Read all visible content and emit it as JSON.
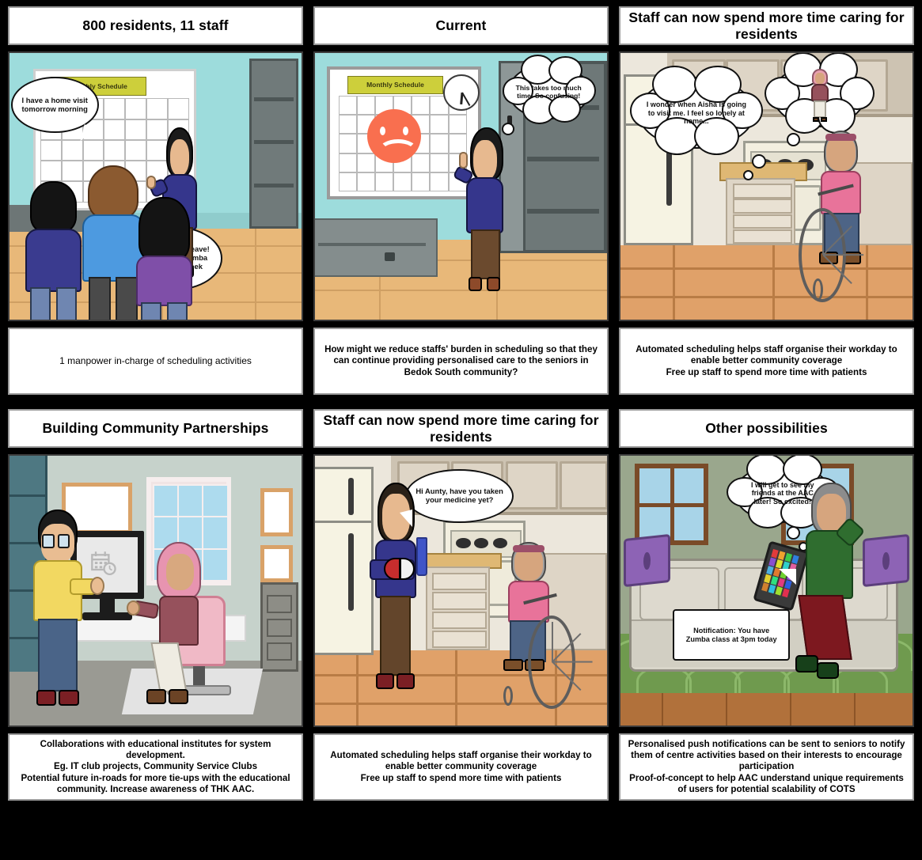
{
  "meta": {
    "kind": "storyboard",
    "rows": 2,
    "columns": 3,
    "accent_header": "#cdcf3b",
    "sad_face_color": "#f96f4f"
  },
  "panels": [
    {
      "id": "panel-1",
      "title": "800 residents, 11 staff",
      "caption": "1 manpower in-charge of scheduling activities",
      "scene": "office-meeting-room",
      "board_title": "Monthly Schedule",
      "bubbles": [
        {
          "kind": "speech",
          "text": "I have a home visit tomorrow morning"
        },
        {
          "kind": "speech",
          "text": "I want to take leave! Cannot run Zumba class next week"
        }
      ]
    },
    {
      "id": "panel-2",
      "title": "Current",
      "caption": "How might we reduce staffs' burden in scheduling so that they can continue providing personalised care to the seniors in Bedok South community?",
      "scene": "office-storeroom",
      "board_title": "Monthly Schedule",
      "bubbles": [
        {
          "kind": "thought",
          "text": "This takes too much time! So confusing!"
        }
      ]
    },
    {
      "id": "panel-3",
      "title": "Staff can now spend more time caring for residents",
      "caption": "Automated scheduling helps staff organise their workday to enable better community coverage\nFree up staff to spend more time with patients",
      "scene": "kitchen-lonely-senior",
      "bubbles": [
        {
          "kind": "thought",
          "text": "I wonder when Aisha is going to visit me. I feel so lonely at home..."
        },
        {
          "kind": "thought-image",
          "text": ""
        }
      ]
    },
    {
      "id": "panel-4",
      "title": "Building Community Partnerships",
      "caption": "Collaborations with educational institutes for system development.\nEg. IT club projects, Community Service Clubs\nPotential future in-roads for more tie-ups with the educational community. Increase awareness of THK AAC.",
      "scene": "office-partnership",
      "bubbles": []
    },
    {
      "id": "panel-5",
      "title": "Staff can now spend more time caring for residents",
      "caption": "Automated scheduling helps staff organise their workday to enable better community coverage\nFree up staff to spend more time with patients",
      "scene": "kitchen-caregiver-visit",
      "bubbles": [
        {
          "kind": "speech",
          "text": "Hi Aunty, have you taken your medicine yet?"
        }
      ]
    },
    {
      "id": "panel-6",
      "title": "Other possibilities",
      "caption": "Personalised push notifications can be sent to seniors to notify them of centre activities based on their interests to encourage participation\nProof-of-concept to help AAC understand unique requirements of users for potential scalability of COTS",
      "scene": "living-room-notification",
      "bubbles": [
        {
          "kind": "thought",
          "text": "I will get to see my friends at the AAC later! So excited!"
        },
        {
          "kind": "speech",
          "text": "Notification: You have Zumba class at 3pm today"
        }
      ]
    }
  ]
}
